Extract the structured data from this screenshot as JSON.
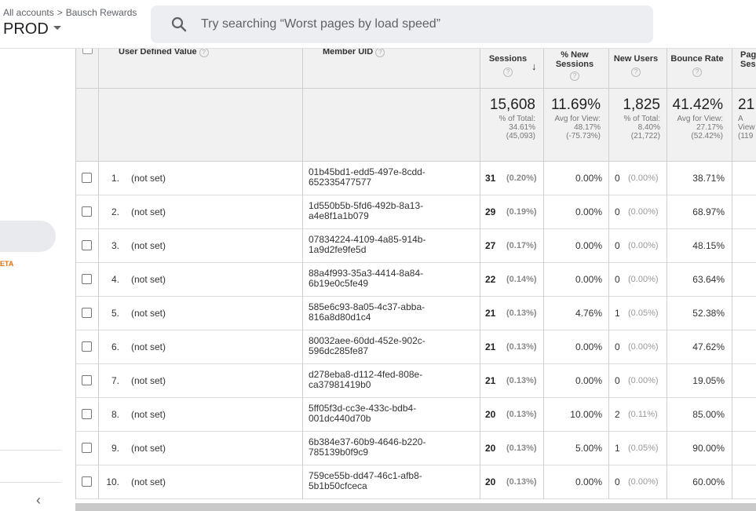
{
  "header": {
    "breadcrumb_root": "All accounts",
    "breadcrumb_sep": ">",
    "breadcrumb_account": "Bausch Rewards",
    "property_name": "PROD",
    "search_placeholder": "Try searching “Worst pages by load speed”"
  },
  "leftnav": {
    "beta_label": "ETA",
    "collapse_glyph": "‹"
  },
  "table": {
    "columns": {
      "udv": "User Defined Value",
      "member_uid": "Member UID",
      "sessions": "Sessions",
      "new_sessions": "% New Sessions",
      "new_users": "New Users",
      "bounce_rate": "Bounce Rate",
      "pages_session": "Pag Ses"
    },
    "help_glyph": "?",
    "sort_glyph": "↓",
    "totals": {
      "sessions": {
        "value": "15,608",
        "l1": "% of Total:",
        "l2": "34.61%",
        "l3": "(45,093)"
      },
      "new_sessions": {
        "value": "11.69%",
        "l1": "Avg for View:",
        "l2": "48.17%",
        "l3": "(-75.73%)"
      },
      "new_users": {
        "value": "1,825",
        "l1": "% of Total:",
        "l2": "8.40%",
        "l3": "(21,722)"
      },
      "bounce_rate": {
        "value": "41.42%",
        "l1": "Avg for View:",
        "l2": "27.17%",
        "l3": "(52.42%)"
      },
      "pages_session": {
        "value": "21",
        "l1": "A",
        "l2": "View",
        "l3": "(119"
      }
    },
    "rows": [
      {
        "rank": "1.",
        "udv": "(not set)",
        "uid1": "01b45bd1-edd5-497e-8cdd-",
        "uid2": "652335477577",
        "sessions": "31",
        "sessions_pct": "(0.20%)",
        "new_sessions": "0.00%",
        "new_users": "0",
        "new_users_pct": "(0.00%)",
        "bounce": "38.71%"
      },
      {
        "rank": "2.",
        "udv": "(not set)",
        "uid1": "1d550b5b-5fd6-492b-8a13-",
        "uid2": "a4e8f1a1b079",
        "sessions": "29",
        "sessions_pct": "(0.19%)",
        "new_sessions": "0.00%",
        "new_users": "0",
        "new_users_pct": "(0.00%)",
        "bounce": "68.97%"
      },
      {
        "rank": "3.",
        "udv": "(not set)",
        "uid1": "07834224-4109-4a85-914b-",
        "uid2": "1a9d2fe9fe5d",
        "sessions": "27",
        "sessions_pct": "(0.17%)",
        "new_sessions": "0.00%",
        "new_users": "0",
        "new_users_pct": "(0.00%)",
        "bounce": "48.15%"
      },
      {
        "rank": "4.",
        "udv": "(not set)",
        "uid1": "88a4f993-35a3-4414-8a84-",
        "uid2": "6b19e0c5fe49",
        "sessions": "22",
        "sessions_pct": "(0.14%)",
        "new_sessions": "0.00%",
        "new_users": "0",
        "new_users_pct": "(0.00%)",
        "bounce": "63.64%"
      },
      {
        "rank": "5.",
        "udv": "(not set)",
        "uid1": "585e6c93-8a05-4c37-abba-",
        "uid2": "816a8d80d1c4",
        "sessions": "21",
        "sessions_pct": "(0.13%)",
        "new_sessions": "4.76%",
        "new_users": "1",
        "new_users_pct": "(0.05%)",
        "bounce": "52.38%"
      },
      {
        "rank": "6.",
        "udv": "(not set)",
        "uid1": "80032aee-60dd-452e-902c-",
        "uid2": "596dc285fe87",
        "sessions": "21",
        "sessions_pct": "(0.13%)",
        "new_sessions": "0.00%",
        "new_users": "0",
        "new_users_pct": "(0.00%)",
        "bounce": "47.62%"
      },
      {
        "rank": "7.",
        "udv": "(not set)",
        "uid1": "d278eba8-d112-4fed-808e-",
        "uid2": "ca37981419b0",
        "sessions": "21",
        "sessions_pct": "(0.13%)",
        "new_sessions": "0.00%",
        "new_users": "0",
        "new_users_pct": "(0.00%)",
        "bounce": "19.05%"
      },
      {
        "rank": "8.",
        "udv": "(not set)",
        "uid1": "5ff05f3d-cc3e-433c-bdb4-",
        "uid2": "001dc440d70b",
        "sessions": "20",
        "sessions_pct": "(0.13%)",
        "new_sessions": "10.00%",
        "new_users": "2",
        "new_users_pct": "(0.11%)",
        "bounce": "85.00%"
      },
      {
        "rank": "9.",
        "udv": "(not set)",
        "uid1": "6b384e37-60b9-4646-b220-",
        "uid2": "785139b0f9c9",
        "sessions": "20",
        "sessions_pct": "(0.13%)",
        "new_sessions": "5.00%",
        "new_users": "1",
        "new_users_pct": "(0.05%)",
        "bounce": "90.00%"
      },
      {
        "rank": "10.",
        "udv": "(not set)",
        "uid1": "759ce55b-dd47-46c1-afb8-",
        "uid2": "5b1b50cfceca",
        "sessions": "20",
        "sessions_pct": "(0.13%)",
        "new_sessions": "0.00%",
        "new_users": "0",
        "new_users_pct": "(0.00%)",
        "bounce": "60.00%"
      }
    ]
  }
}
